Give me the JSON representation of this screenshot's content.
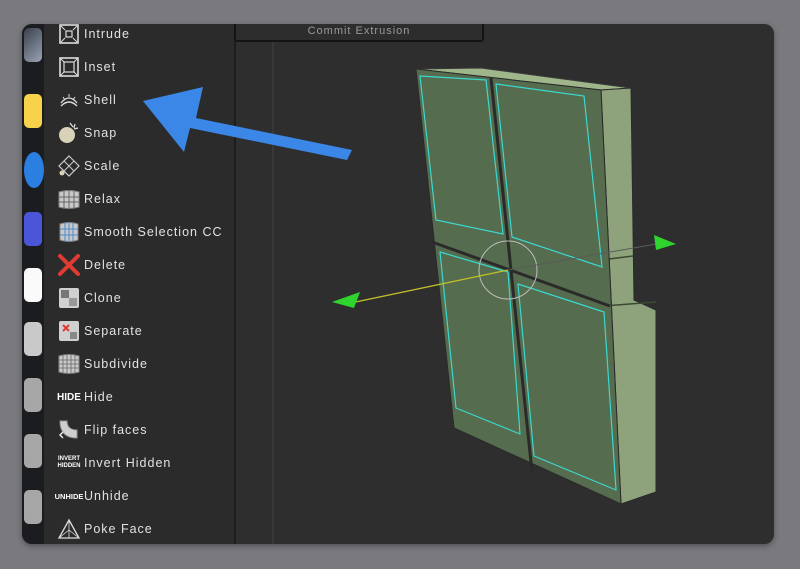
{
  "top_button": {
    "label": "Commit Extrusion"
  },
  "tools": [
    {
      "label": "Intrude",
      "icon": "intrude-icon"
    },
    {
      "label": "Inset",
      "icon": "inset-icon"
    },
    {
      "label": "Shell",
      "icon": "shell-icon"
    },
    {
      "label": "Snap",
      "icon": "snap-icon"
    },
    {
      "label": "Scale",
      "icon": "scale-icon"
    },
    {
      "label": "Relax",
      "icon": "relax-icon"
    },
    {
      "label": "Smooth Selection CC",
      "icon": "smooth-selection-icon"
    },
    {
      "label": "Delete",
      "icon": "delete-icon"
    },
    {
      "label": "Clone",
      "icon": "clone-icon"
    },
    {
      "label": "Separate",
      "icon": "separate-icon"
    },
    {
      "label": "Subdivide",
      "icon": "subdivide-icon"
    },
    {
      "label": "Hide",
      "icon": "hide-icon",
      "icon_text": "HIDE"
    },
    {
      "label": "Flip faces",
      "icon": "flip-faces-icon"
    },
    {
      "label": "Invert Hidden",
      "icon": "invert-hidden-icon",
      "icon_text": "INVERT HIDDEN"
    },
    {
      "label": "Unhide",
      "icon": "unhide-icon",
      "icon_text": "UNHIDE"
    },
    {
      "label": "Poke Face",
      "icon": "poke-face-icon"
    }
  ],
  "colors": {
    "panel_bg": "#2b2b2b",
    "viewport_bg": "#2e2e2e",
    "arrow_blue": "#3a87e8",
    "mesh_green": "#8ea37b",
    "wire_cyan": "#3ad8d0",
    "gizmo_green": "#2fd52f",
    "gizmo_yellow": "#bfbf2a"
  }
}
